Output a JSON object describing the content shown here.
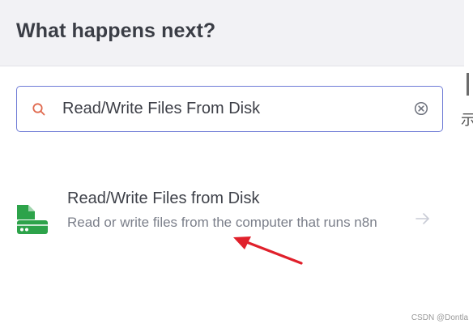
{
  "header": {
    "title": "What happens next?"
  },
  "search": {
    "value": "Read/Write Files From Disk"
  },
  "result": {
    "name": "Read/Write Files from Disk",
    "description": "Read or write files from the computer that runs n8n"
  },
  "edge": {
    "glyph": "示"
  },
  "watermark": {
    "text": "CSDN @Dontla"
  },
  "icons": {
    "search": "search-icon",
    "clear": "clear-icon",
    "node": "file-disk-icon",
    "arrow": "arrow-right-icon"
  },
  "colors": {
    "search_border": "#6e7bd6",
    "search_icon": "#e06a4f",
    "node_icon": "#2da34a",
    "annotation_arrow": "#e0202b"
  }
}
